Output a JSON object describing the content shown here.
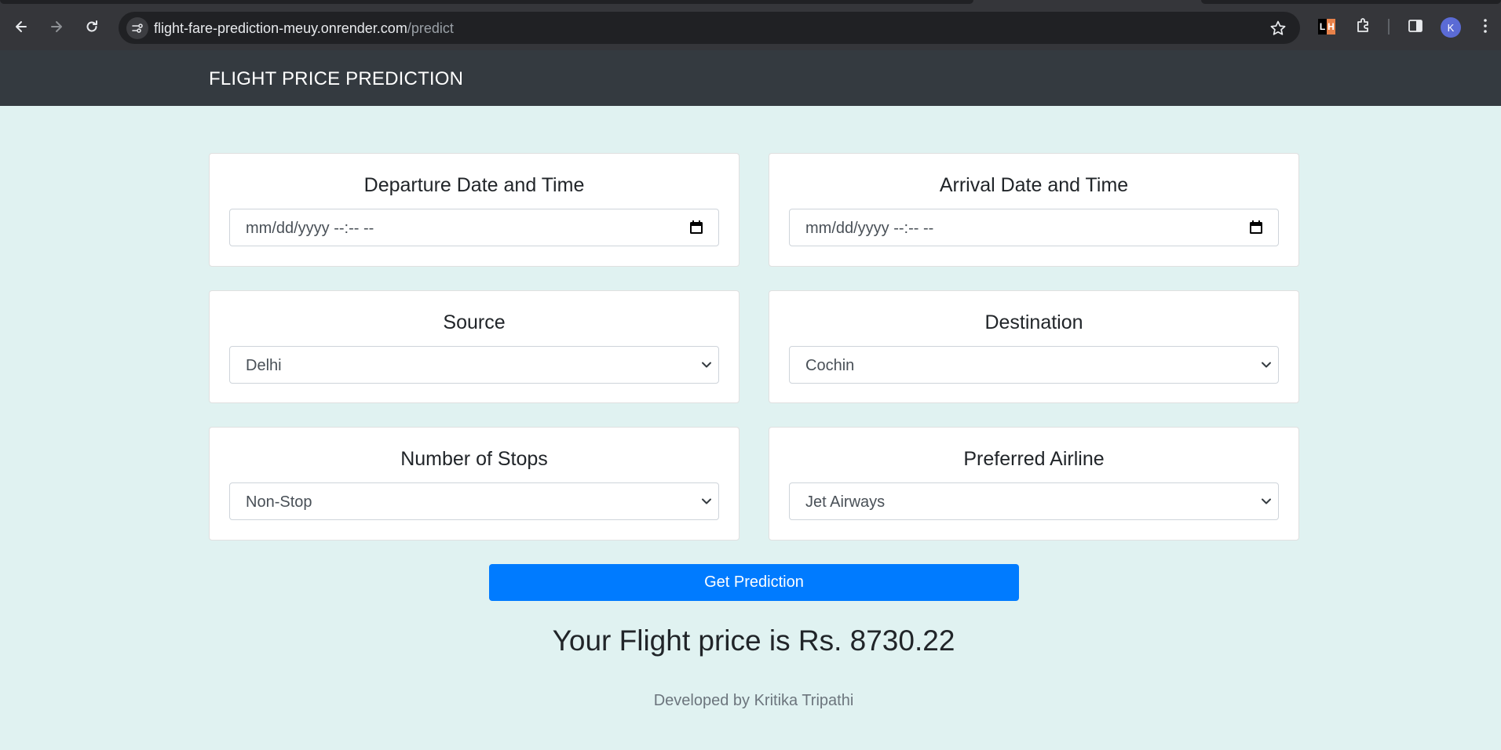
{
  "browser": {
    "url_host": "flight-fare-prediction-meuy.onrender.com",
    "url_path": "/predict",
    "profile_initial": "K",
    "extension_lh": [
      "L",
      "H"
    ]
  },
  "navbar": {
    "brand": "FLIGHT PRICE PREDICTION"
  },
  "form": {
    "departure": {
      "label": "Departure Date and Time",
      "placeholder": "mm/dd/yyyy --:-- --"
    },
    "arrival": {
      "label": "Arrival Date and Time",
      "placeholder": "mm/dd/yyyy --:-- --"
    },
    "source": {
      "label": "Source",
      "value": "Delhi"
    },
    "destination": {
      "label": "Destination",
      "value": "Cochin"
    },
    "stops": {
      "label": "Number of Stops",
      "value": "Non-Stop"
    },
    "airline": {
      "label": "Preferred Airline",
      "value": "Jet Airways"
    },
    "submit_label": "Get Prediction"
  },
  "result": {
    "text": "Your Flight price is Rs. 8730.22"
  },
  "footer": {
    "text": "Developed by Kritika Tripathi"
  },
  "colors": {
    "accent": "#007bff",
    "navbar": "#343a40",
    "background": "#e0f2f1"
  }
}
